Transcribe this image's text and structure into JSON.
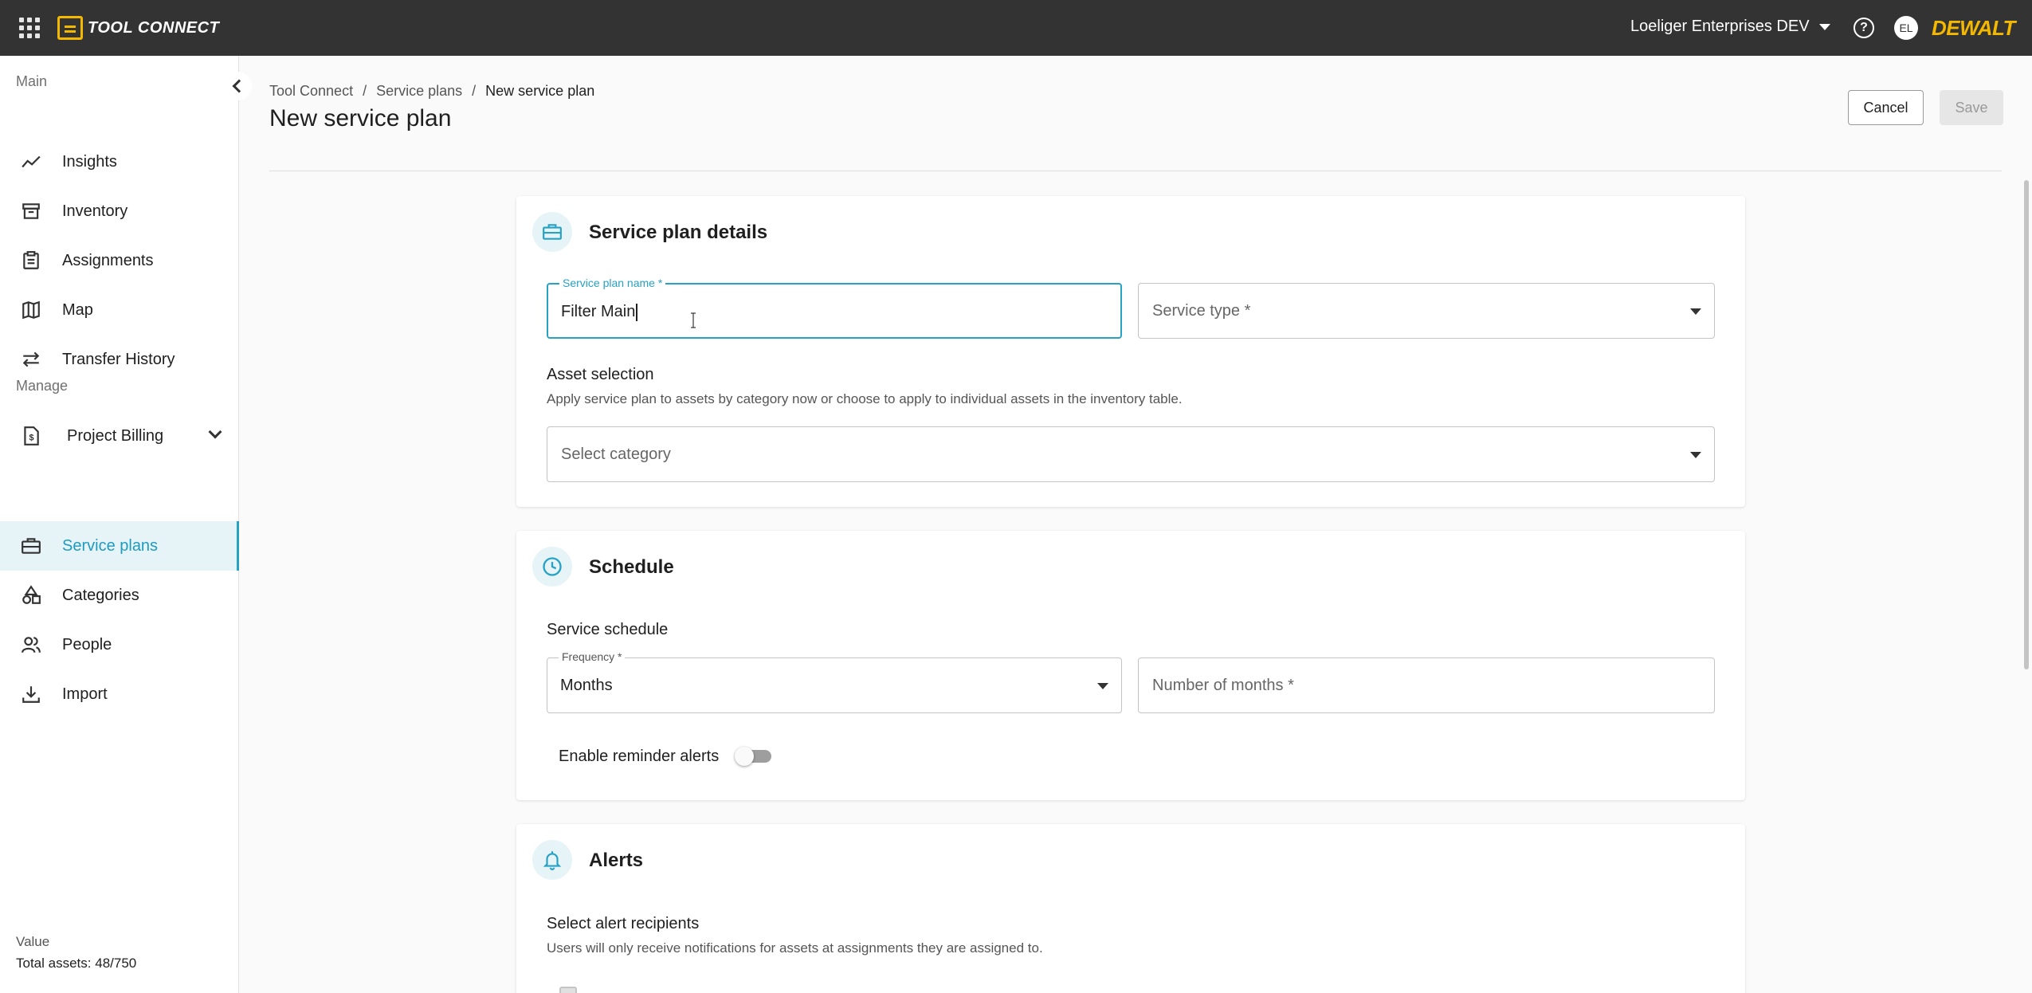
{
  "topbar": {
    "app_name": "TOOL CONNECT",
    "org_name": "Loeliger Enterprises DEV",
    "help_glyph": "?",
    "avatar_initials": "EL",
    "brand": "DEWALT",
    "accent_color": "#f5b800"
  },
  "sidebar": {
    "main_heading": "Main",
    "manage_heading": "Manage",
    "main_items": [
      {
        "label": "Insights",
        "icon": "trend-line-icon"
      },
      {
        "label": "Inventory",
        "icon": "archive-box-icon"
      },
      {
        "label": "Assignments",
        "icon": "clipboard-list-icon"
      },
      {
        "label": "Map",
        "icon": "map-icon"
      },
      {
        "label": "Transfer History",
        "icon": "arrows-exchange-icon"
      }
    ],
    "manage_items": [
      {
        "label": "Project Billing",
        "icon": "billing-document-icon",
        "expandable": true
      },
      {
        "label": "Service plans",
        "icon": "toolbox-icon",
        "active": true
      },
      {
        "label": "Categories",
        "icon": "shapes-icon"
      },
      {
        "label": "People",
        "icon": "people-icon"
      },
      {
        "label": "Import",
        "icon": "download-icon"
      }
    ],
    "footer": {
      "heading": "Value",
      "total_assets_label": "Total assets:",
      "total_assets_value": "48/750"
    },
    "active_color": "#27a1c4"
  },
  "breadcrumb": {
    "items": [
      "Tool Connect",
      "Service plans",
      "New service plan"
    ],
    "separator": "/"
  },
  "page": {
    "title": "New service plan",
    "cancel_label": "Cancel",
    "save_label": "Save"
  },
  "details": {
    "title": "Service plan details",
    "name_label": "Service plan name *",
    "name_value": "Filter Main",
    "service_type_placeholder": "Service type *",
    "asset_selection_label": "Asset selection",
    "asset_selection_help": "Apply service plan to assets by category now or choose to apply to individual assets in the inventory table.",
    "category_placeholder": "Select category"
  },
  "schedule": {
    "title": "Schedule",
    "service_schedule_label": "Service schedule",
    "frequency_label": "Frequency *",
    "frequency_value": "Months",
    "months_placeholder": "Number of months *",
    "reminder_label": "Enable reminder alerts",
    "reminder_enabled": false
  },
  "alerts": {
    "title": "Alerts",
    "recipients_label": "Select alert recipients",
    "recipients_help": "Users will only receive notifications for assets at assignments they are assigned to."
  }
}
